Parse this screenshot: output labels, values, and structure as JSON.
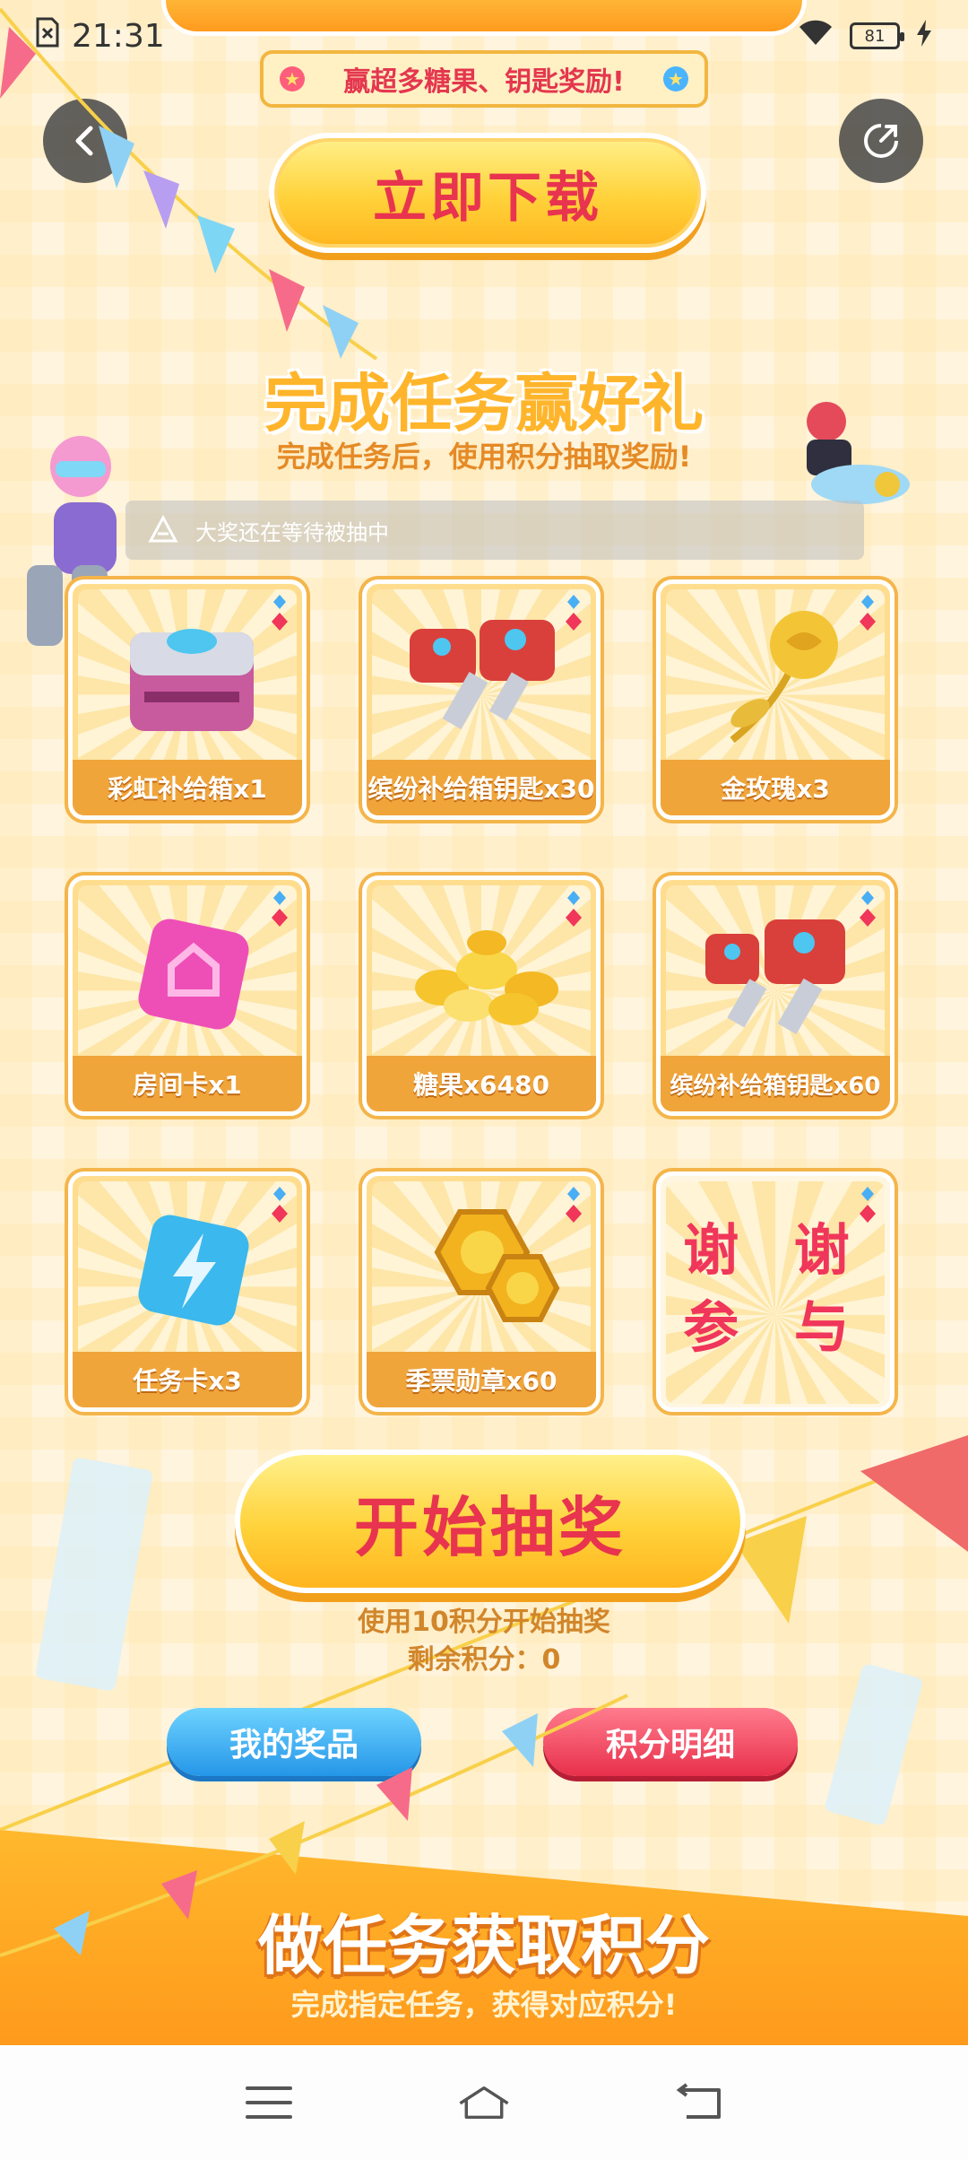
{
  "status_bar": {
    "time": "21:31",
    "battery": "81"
  },
  "hero": {
    "ribbon_text": "赢超多糖果、钥匙奖励!",
    "download_label": "立即下载"
  },
  "tasks": {
    "title": "完成任务赢好礼",
    "subtitle": "完成任务后，使用积分抽取奖励!",
    "notice": "大奖还在等待被抽中"
  },
  "prizes": [
    {
      "label": "彩虹补给箱x1"
    },
    {
      "label": "缤纷补给箱钥匙x30"
    },
    {
      "label": "金玫瑰x3"
    },
    {
      "label": "房间卡x1"
    },
    {
      "label": "糖果x6480"
    },
    {
      "label": "缤纷补给箱钥匙x60"
    },
    {
      "label": "任务卡x3"
    },
    {
      "label": "季票勋章x60"
    },
    {
      "label": "",
      "thanks_line1": "谢 谢",
      "thanks_line2": "参 与"
    }
  ],
  "draw": {
    "button_label": "开始抽奖",
    "cost_text": "使用10积分开始抽奖",
    "remaining_text": "剩余积分：0"
  },
  "buttons": {
    "my_prizes": "我的奖品",
    "points_detail": "积分明细"
  },
  "earn": {
    "title": "做任务获取积分",
    "subtitle": "完成指定任务，获得对应积分!"
  },
  "colors": {
    "accent_red": "#e8344e",
    "accent_yellow": "#ffd23a",
    "card_orange": "#f0a53a"
  }
}
